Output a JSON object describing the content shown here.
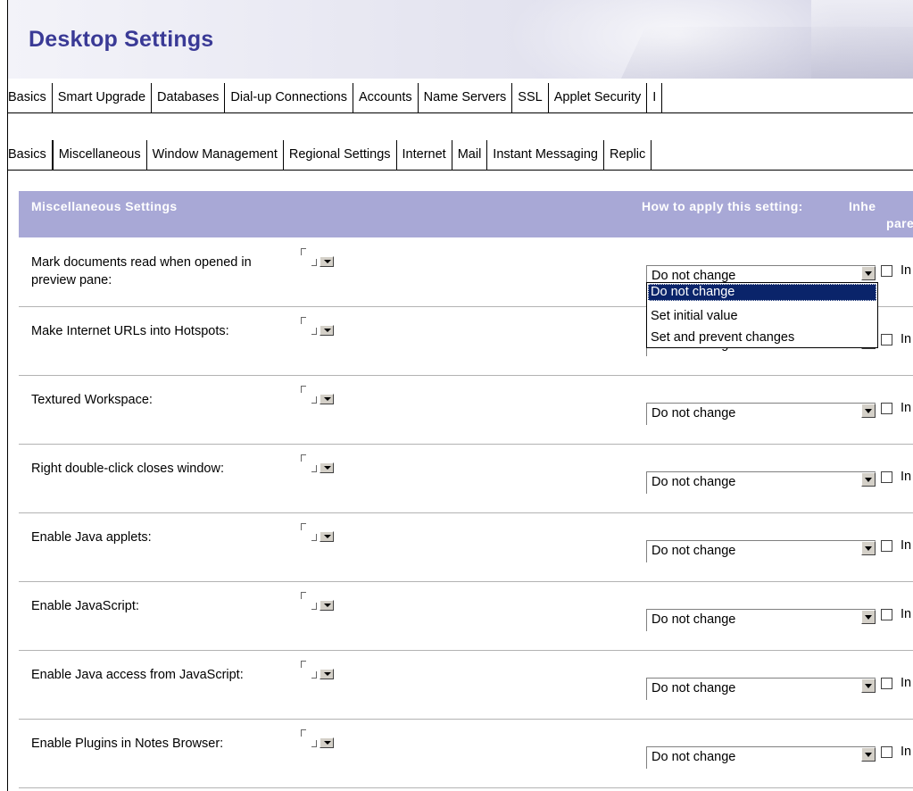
{
  "header": {
    "title": "Desktop Settings"
  },
  "top_tabs": [
    {
      "label": "Basics"
    },
    {
      "label": "Smart Upgrade"
    },
    {
      "label": "Databases"
    },
    {
      "label": "Dial-up Connections"
    },
    {
      "label": "Accounts"
    },
    {
      "label": "Name Servers"
    },
    {
      "label": "SSL"
    },
    {
      "label": "Applet Security"
    },
    {
      "label": "I"
    }
  ],
  "sub_tabs": [
    {
      "label": "Basics"
    },
    {
      "label": "Miscellaneous",
      "active": true
    },
    {
      "label": "Window Management"
    },
    {
      "label": "Regional Settings"
    },
    {
      "label": "Internet"
    },
    {
      "label": "Mail"
    },
    {
      "label": "Instant Messaging"
    },
    {
      "label": "Replic"
    }
  ],
  "section": {
    "title": "Miscellaneous Settings",
    "apply_header": "How to apply this setting:",
    "inherit_header_1": "Inhe",
    "inherit_header_2": "pare"
  },
  "rows": [
    {
      "label": "Mark documents read when opened in preview pane:",
      "value": "Do not change",
      "inherit": "In",
      "inherit_checked": false
    },
    {
      "label": "Make Internet URLs into Hotspots:",
      "value": "Do not change",
      "inherit": "In",
      "inherit_checked": false
    },
    {
      "label": "Textured Workspace:",
      "value": "Do not change",
      "inherit": "In",
      "inherit_checked": false
    },
    {
      "label": "Right double-click closes window:",
      "value": "Do not change",
      "inherit": "In",
      "inherit_checked": false
    },
    {
      "label": "Enable Java applets:",
      "value": "Do not change",
      "inherit": "In",
      "inherit_checked": false
    },
    {
      "label": "Enable JavaScript:",
      "value": "Do not change",
      "inherit": "In",
      "inherit_checked": false
    },
    {
      "label": "Enable Java access from JavaScript:",
      "value": "Do not change",
      "inherit": "In",
      "inherit_checked": false
    },
    {
      "label": "Enable Plugins in Notes Browser:",
      "value": "Do not change",
      "inherit": "In",
      "inherit_checked": false
    }
  ],
  "dropdown": {
    "open_for_row": 0,
    "options": [
      "Do not change",
      "Set initial value",
      "Set and prevent changes"
    ],
    "highlighted": "Do not change"
  }
}
